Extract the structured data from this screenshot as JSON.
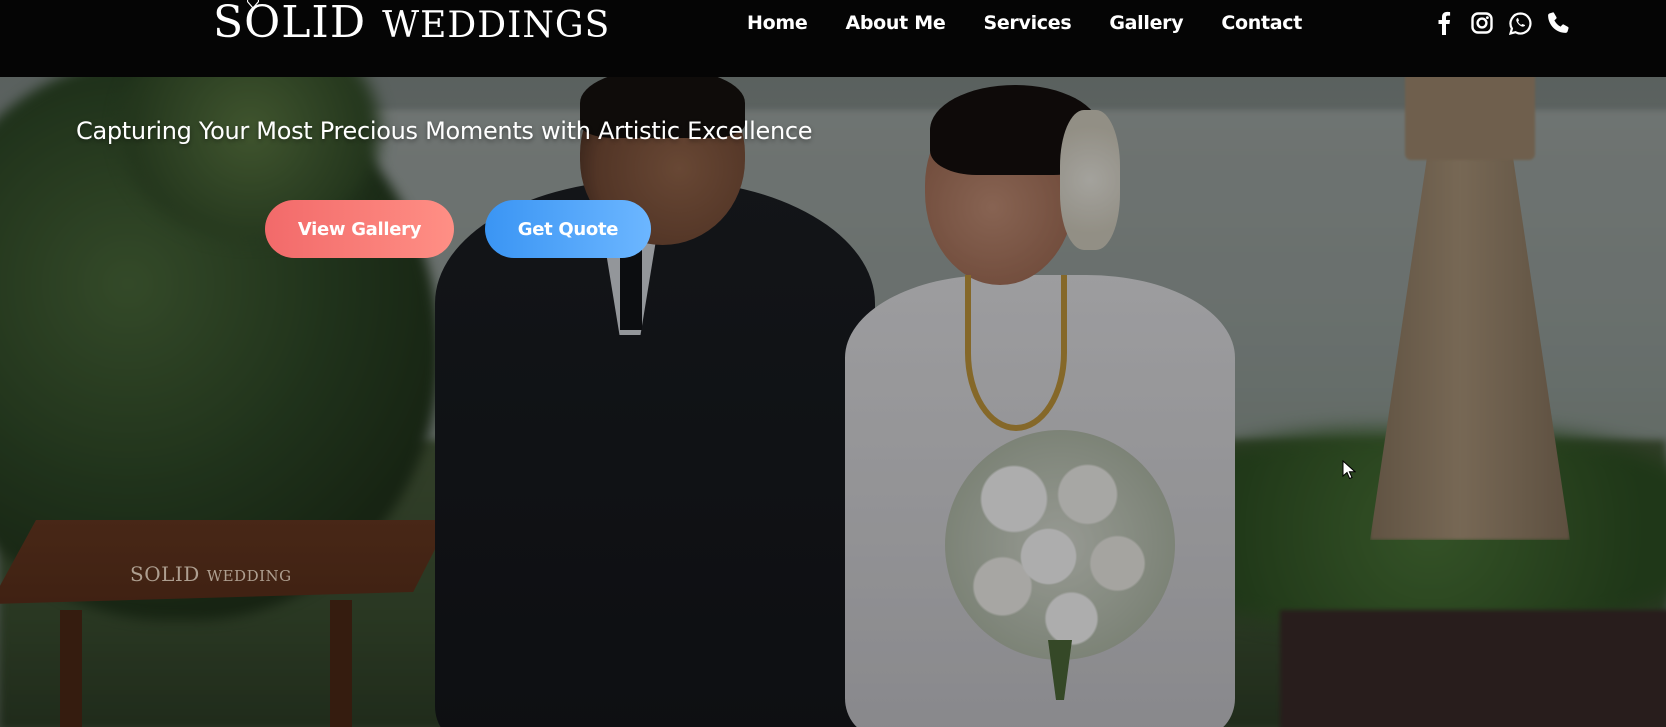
{
  "brand": {
    "logo_primary": "SOLID",
    "logo_secondary": "WEDDINGS"
  },
  "nav": {
    "links": [
      "Home",
      "About Me",
      "Services",
      "Gallery",
      "Contact"
    ]
  },
  "social": {
    "icons": [
      "facebook-icon",
      "instagram-icon",
      "whatsapp-icon",
      "phone-icon"
    ]
  },
  "hero": {
    "tagline": "Capturing Your Most Precious Moments with Artistic Excellence",
    "primary_button": "View Gallery",
    "secondary_button": "Get Quote",
    "watermark_primary": "SOLID",
    "watermark_secondary": "WEDDING"
  },
  "colors": {
    "navbar_bg": "#050505",
    "primary_button": "#f26a6a",
    "secondary_button": "#3a95f4",
    "text": "#ffffff"
  }
}
